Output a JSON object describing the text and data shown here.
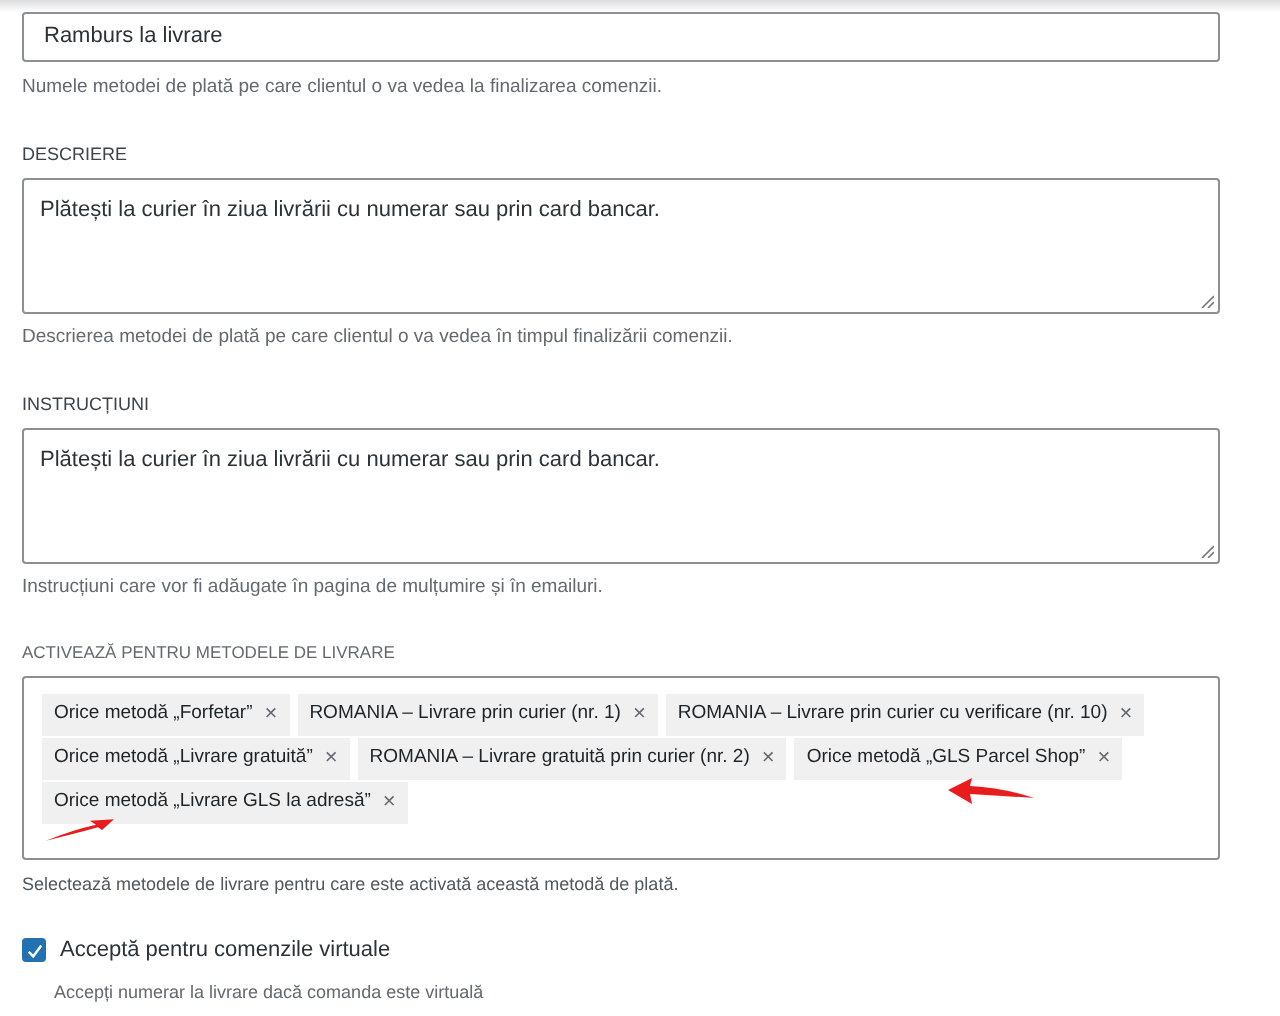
{
  "title_field": {
    "value": "Ramburs la livrare",
    "help": "Numele metodei de plată pe care clientul o va vedea la finalizarea comenzii."
  },
  "description": {
    "label": "DESCRIERE",
    "value": "Plătești la curier în ziua livrării cu numerar sau prin card bancar.",
    "help": "Descrierea metodei de plată pe care clientul o va vedea în timpul finalizării comenzii."
  },
  "instructions": {
    "label": "INSTRUCȚIUNI",
    "value": "Plătești la curier în ziua livrării cu numerar sau prin card bancar.",
    "help": "Instrucțiuni care vor fi adăugate în pagina de mulțumire și în emailuri."
  },
  "shipping_methods": {
    "label": "ACTIVEAZĂ PENTRU METODELE DE LIVRARE",
    "help": "Selectează metodele de livrare pentru care este activată această metodă de plată.",
    "tags": [
      {
        "label": "Orice metodă „Forfetar”",
        "remove": "×"
      },
      {
        "label": "ROMANIA – Livrare prin curier (nr. 1)",
        "remove": "×"
      },
      {
        "label": "ROMANIA – Livrare prin curier cu verificare (nr. 10)",
        "remove": "×"
      },
      {
        "label": "Orice metodă „Livrare gratuită”",
        "remove": "×"
      },
      {
        "label": "ROMANIA – Livrare gratuită prin curier (nr. 2)",
        "remove": "×"
      },
      {
        "label": "Orice metodă „GLS Parcel Shop”",
        "remove": "×"
      },
      {
        "label": "Orice metodă „Livrare GLS la adresă”",
        "remove": "×"
      }
    ]
  },
  "virtual_orders": {
    "label": "Acceptă pentru comenzile virtuale",
    "checked": true,
    "help": "Accepți numerar la livrare dacă comanda este virtuală"
  }
}
